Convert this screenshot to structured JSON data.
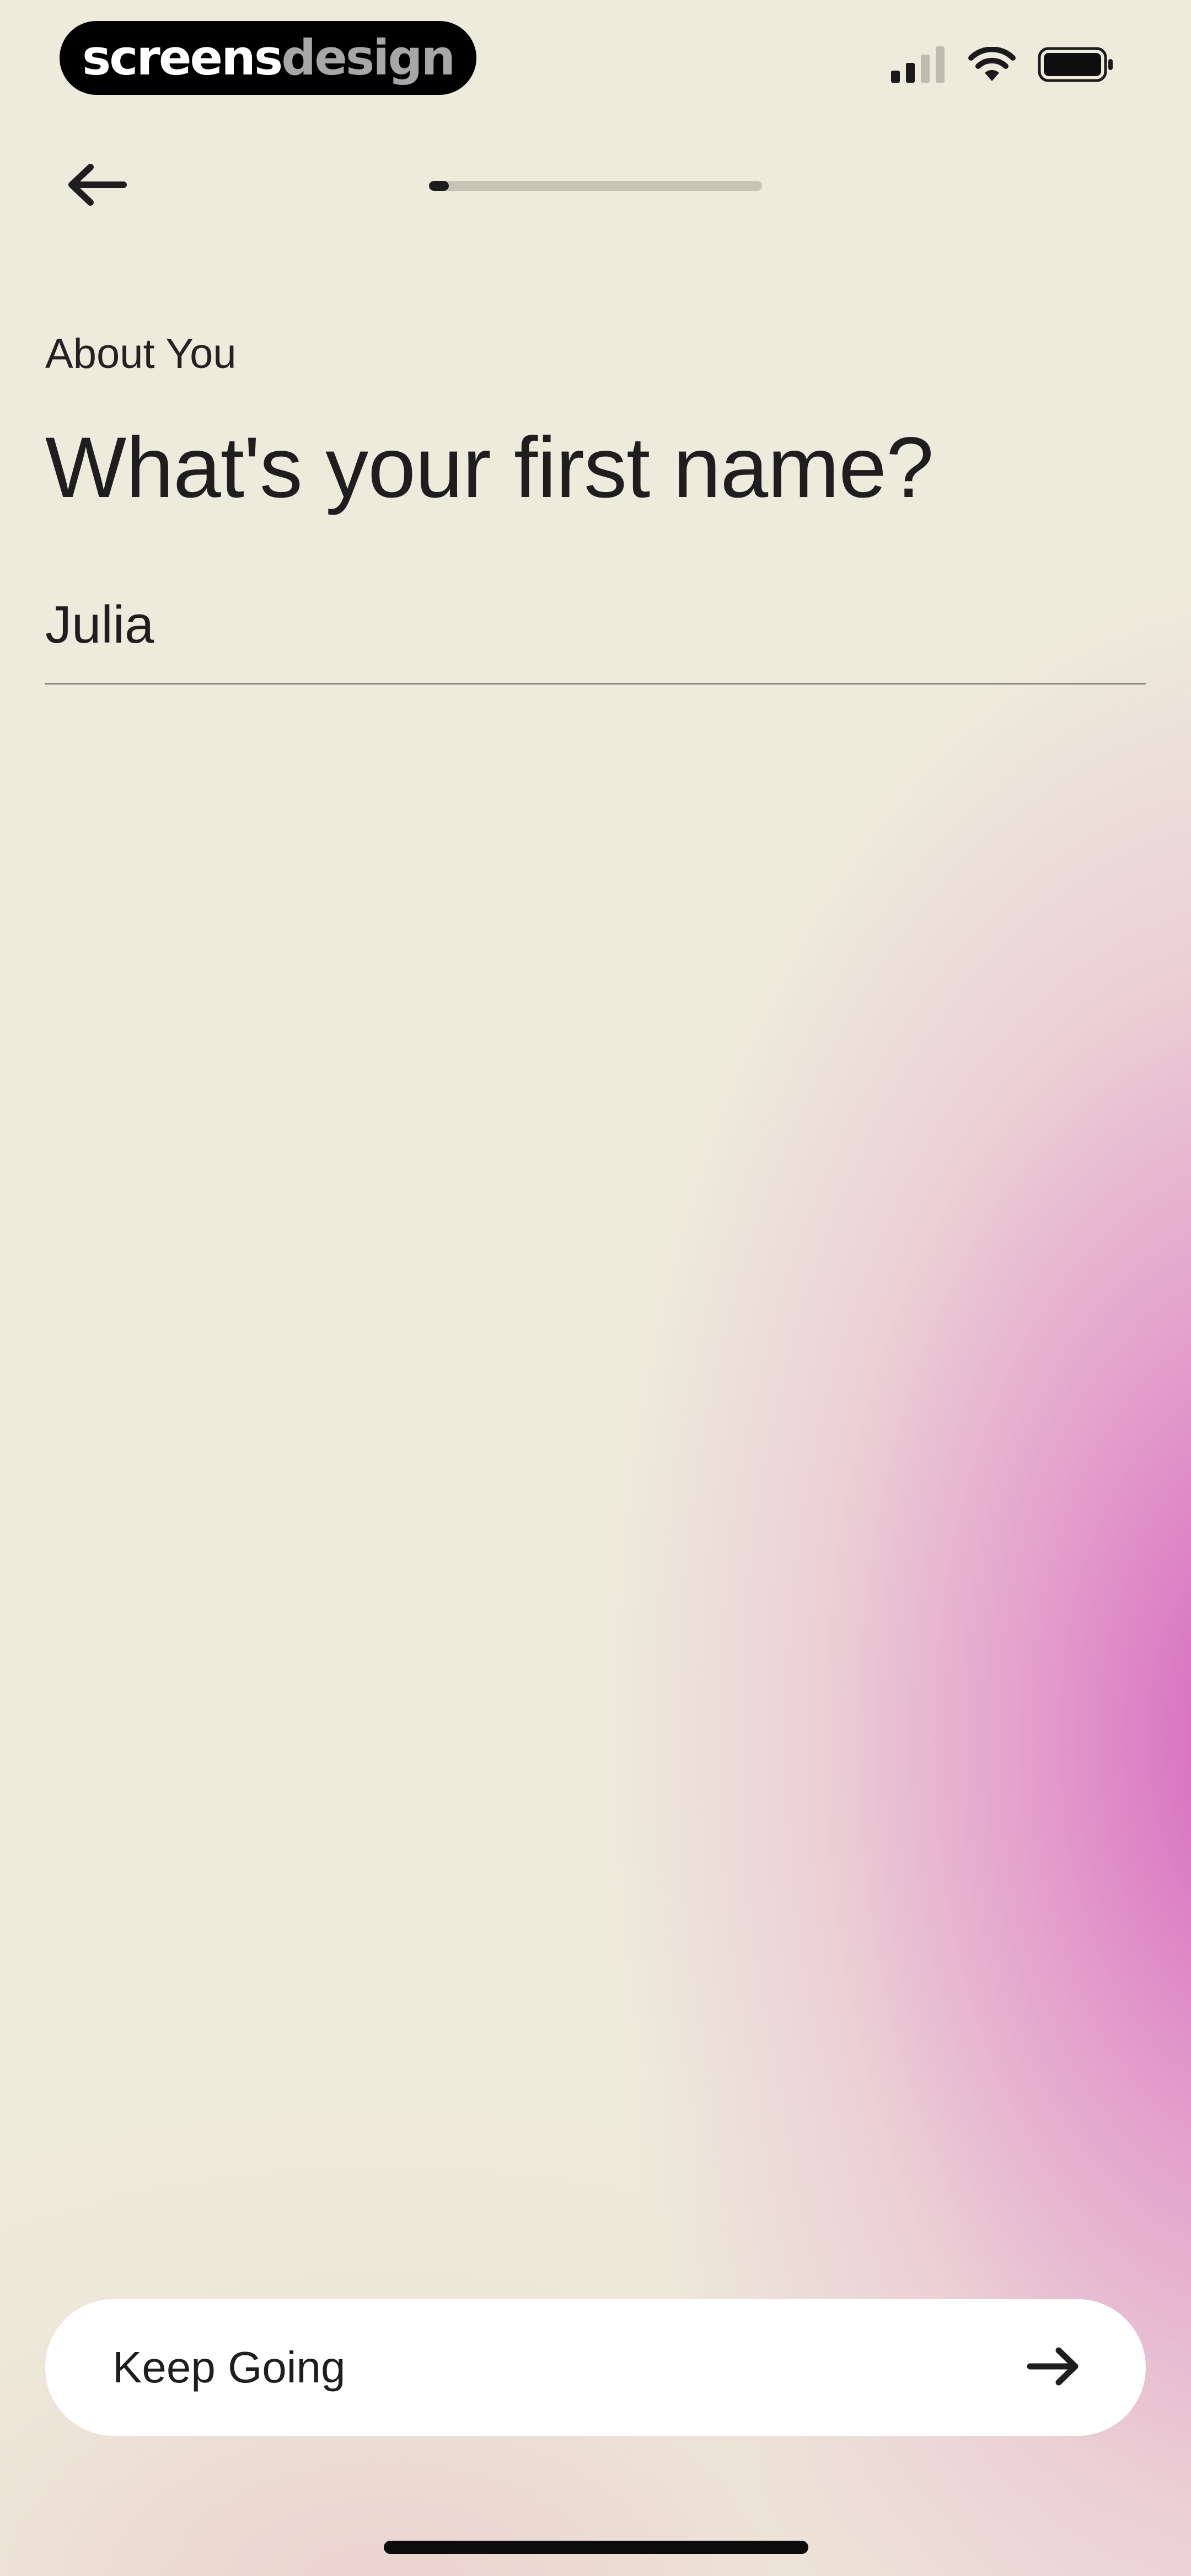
{
  "status_bar": {
    "brand_part1": "screens",
    "brand_part2": "design",
    "icons": [
      "signal-icon",
      "wifi-icon",
      "battery-icon"
    ]
  },
  "nav": {
    "back_icon": "arrow-left-icon",
    "progress_fraction": 0.06
  },
  "content": {
    "section_label": "About You",
    "question": "What's your first name?",
    "name_value": "Julia"
  },
  "footer": {
    "button_label": "Keep Going",
    "button_icon": "arrow-right-icon"
  },
  "colors": {
    "background": "#edecdc",
    "accent_gradient": "#d360be",
    "text": "#1e1e1e",
    "button_bg": "#ffffff"
  }
}
